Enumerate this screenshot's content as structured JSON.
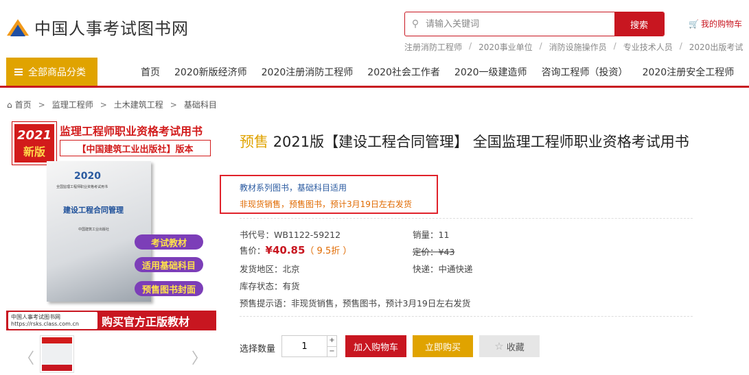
{
  "header": {
    "logo_text": "中国人事考试图书网",
    "search_placeholder": "请输入关键词",
    "search_button": "搜索",
    "cart_label": "我的购物车",
    "hot_links": [
      "注册消防工程师",
      "2020事业单位",
      "消防设施操作员",
      "专业技术人员",
      "2020出版考试"
    ]
  },
  "nav": {
    "all_categories": "全部商品分类",
    "items": [
      "首页",
      "2020新版经济师",
      "2020注册消防工程师",
      "2020社会工作者",
      "2020一级建造师",
      "咨询工程师（投资）",
      "2020注册安全工程师"
    ]
  },
  "breadcrumb": [
    "首页",
    "监理工程师",
    "土木建筑工程",
    "基础科目"
  ],
  "cover": {
    "badge_year": "2021",
    "badge_new": "新版",
    "title": "监理工程师职业资格考试用书",
    "subtitle": "【中国建筑工业出版社】版本",
    "book_year": "2020",
    "book_series": "全国监理工程师职业资格考试用书",
    "book_title": "建设工程合同管理",
    "book_publisher": "中国建筑工业出版社",
    "tags": [
      "考试教材",
      "适用基础科目",
      "预售图书封面"
    ],
    "footer_logo_name": "中国人事考试图书网",
    "footer_logo_url": "https://rsks.class.com.cn",
    "footer_text": "购买官方正版教材"
  },
  "product": {
    "presale_label": "预售",
    "title": "2021版【建设工程合同管理】 全国监理工程师职业资格考试用书",
    "promo_line1": "教材系列图书，基础科目适用",
    "promo_line2": "非现货销售，预售图书，预计3月19日左右发货",
    "code_label": "书代号：",
    "code": "WB1122-59212",
    "sales_label": "销量：",
    "sales": "11",
    "price_label": "售价：",
    "price": "¥40.85",
    "discount": "（ 9.5折 ）",
    "list_price_label": "定价：",
    "list_price": "¥43",
    "ship_from_label": "发货地区：",
    "ship_from": "北京",
    "courier_label": "快递：",
    "courier": "中通快递",
    "stock_label": "库存状态：",
    "stock": "有货",
    "presale_note_label": "预售提示语：",
    "presale_note": "非现货销售，预售图书，预计3月19日左右发货"
  },
  "purchase": {
    "qty_label": "选择数量",
    "qty_value": "1",
    "add_to_cart": "加入购物车",
    "buy_now": "立即购买",
    "favorite": "收藏"
  },
  "colors": {
    "brand_red": "#c81620",
    "accent_gold": "#e0a300",
    "link_blue": "#2a5aa0",
    "promo_orange": "#e06a00"
  }
}
